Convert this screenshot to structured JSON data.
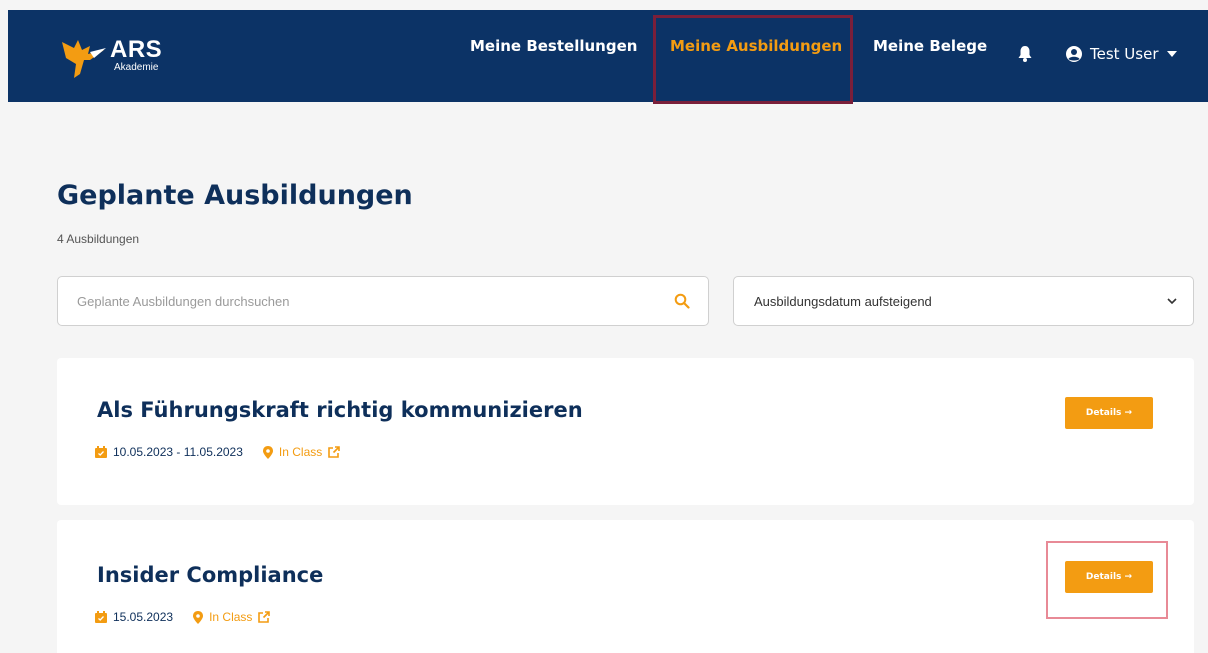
{
  "brand": {
    "name": "ARS",
    "subtitle": "Akademie",
    "accent": "#f39c12",
    "navy": "#0c3366"
  },
  "nav": {
    "orders": "Meine Bestellungen",
    "trainings": "Meine Ausbildungen",
    "receipts": "Meine Belege",
    "bell_icon": "bell-icon",
    "user": "Test User"
  },
  "page": {
    "title": "Geplante Ausbildungen",
    "count": "4 Ausbildungen"
  },
  "search": {
    "placeholder": "Geplante Ausbildungen durchsuchen"
  },
  "sort": {
    "selected": "Ausbildungsdatum aufsteigend"
  },
  "courses": [
    {
      "title": "Als Führungskraft richtig kommunizieren",
      "date": "10.05.2023 - 11.05.2023",
      "location": "In Class",
      "button": "Details →"
    },
    {
      "title": "Insider Compliance",
      "date": "15.05.2023",
      "location": "In Class",
      "button": "Details →"
    }
  ]
}
